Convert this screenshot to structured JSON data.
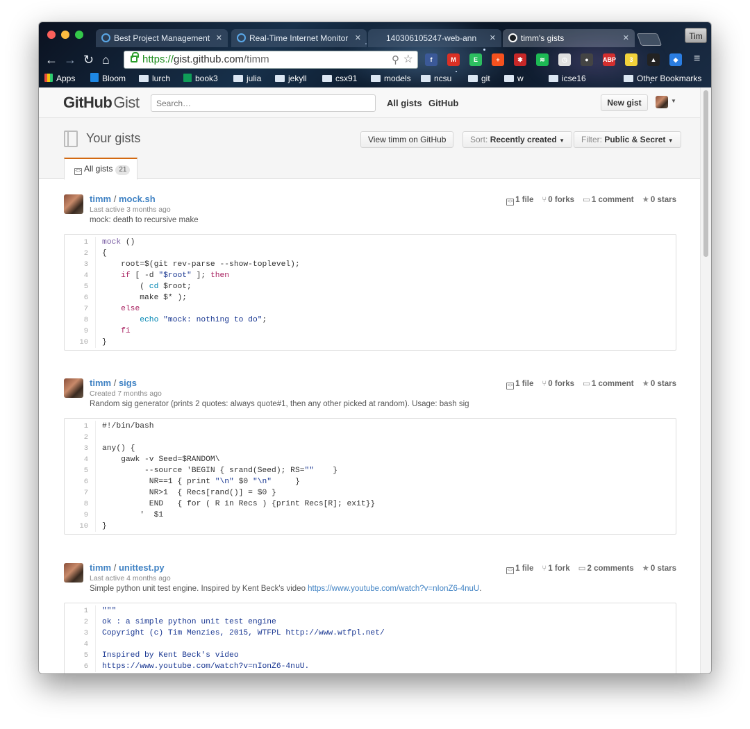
{
  "browser": {
    "tabs": [
      {
        "title": "Best Project Management",
        "icon": "loading-icon"
      },
      {
        "title": "Real-Time Internet Monitor",
        "icon": "loading-icon"
      },
      {
        "title": "140306105247-web-ann",
        "icon": "page-icon"
      },
      {
        "title": "timm's gists",
        "icon": "github-icon"
      }
    ],
    "profile_name": "Tim",
    "url_scheme": "https://",
    "url_host": "gist.github.com",
    "url_path": "/timm",
    "bookmarks": [
      "Apps",
      "Bloom",
      "lurch",
      "book3",
      "julia",
      "jekyll",
      "csx91",
      "models",
      "ncsu",
      "git",
      "w",
      "icse16",
      "Other Bookmarks"
    ],
    "extensions": [
      {
        "name": "facebook-icon",
        "color": "#3b5998",
        "label": "f"
      },
      {
        "name": "gmail-icon",
        "color": "#d93025",
        "label": "M"
      },
      {
        "name": "evernote-icon",
        "color": "#2dbe60",
        "label": "E"
      },
      {
        "name": "plus-icon",
        "color": "#f4511e",
        "label": "+"
      },
      {
        "name": "bug-icon",
        "color": "#c62828",
        "label": "✱"
      },
      {
        "name": "spotify-icon",
        "color": "#1db954",
        "label": "≋"
      },
      {
        "name": "clock-icon",
        "color": "#e0e0e0",
        "label": "◷"
      },
      {
        "name": "dark-ext-icon",
        "color": "#444444",
        "label": "●"
      },
      {
        "name": "adblock-icon",
        "color": "#d32f2f",
        "label": "ABP"
      },
      {
        "name": "notes-icon",
        "color": "#f2d23b",
        "label": "3"
      },
      {
        "name": "cap-icon",
        "color": "#222222",
        "label": "▲"
      },
      {
        "name": "send-icon",
        "color": "#2a7de1",
        "label": "◆"
      }
    ]
  },
  "header": {
    "logo_a": "GitHub",
    "logo_b": "Gist",
    "search_placeholder": "Search…",
    "nav": [
      "All gists",
      "GitHub"
    ],
    "new_gist": "New gist"
  },
  "subheader": {
    "title": "Your gists",
    "view_on_github": "View timm on GitHub",
    "sort_label": "Sort:",
    "sort_value": "Recently created",
    "filter_label": "Filter:",
    "filter_value": "Public & Secret",
    "tab_label": "All gists",
    "tab_count": "21"
  },
  "gists": [
    {
      "owner": "timm",
      "name": "mock.sh",
      "meta": "Last active 3 months ago",
      "desc": "mock: death to recursive make",
      "desc_link": "",
      "desc_end": "",
      "files": "1 file",
      "forks": "0 forks",
      "comments": "1 comment",
      "stars": "0 stars",
      "lines": [
        "mock ()",
        "{",
        "    root=$(git rev-parse --show-toplevel);",
        "    if [ -d \"$root\" ]; then",
        "        ( cd $root;",
        "        make $* );",
        "    else",
        "        echo \"mock: nothing to do\";",
        "    fi",
        "}"
      ]
    },
    {
      "owner": "timm",
      "name": "sigs",
      "meta": "Created 7 months ago",
      "desc": "Random sig generator (prints 2 quotes: always quote#1, then any other picked at random). Usage: bash sig",
      "desc_link": "",
      "desc_end": "",
      "files": "1 file",
      "forks": "0 forks",
      "comments": "1 comment",
      "stars": "0 stars",
      "lines": [
        "#!/bin/bash",
        "",
        "any() {",
        "    gawk -v Seed=$RANDOM\\",
        "         --source 'BEGIN { srand(Seed); RS=\"\"    }",
        "          NR==1 { print \"\\n\" $0 \"\\n\"     }",
        "          NR>1  { Recs[rand()] = $0 }",
        "          END   { for ( R in Recs ) {print Recs[R]; exit}}",
        "        '  $1",
        "}"
      ]
    },
    {
      "owner": "timm",
      "name": "unittest.py",
      "meta": "Last active 4 months ago",
      "desc": "Simple python unit test engine. Inspired by Kent Beck's video ",
      "desc_link": "https://www.youtube.com/watch?v=nIonZ6-4nuU",
      "desc_end": ".",
      "files": "1 file",
      "forks": "1 fork",
      "comments": "2 comments",
      "stars": "0 stars",
      "lines": [
        "\"\"\"",
        "ok : a simple python unit test engine",
        "Copyright (c) Tim Menzies, 2015, WTFPL http://www.wtfpl.net/",
        "",
        "Inspired by Kent Beck's video",
        "https://www.youtube.com/watch?v=nIonZ6-4nuU."
      ]
    }
  ]
}
